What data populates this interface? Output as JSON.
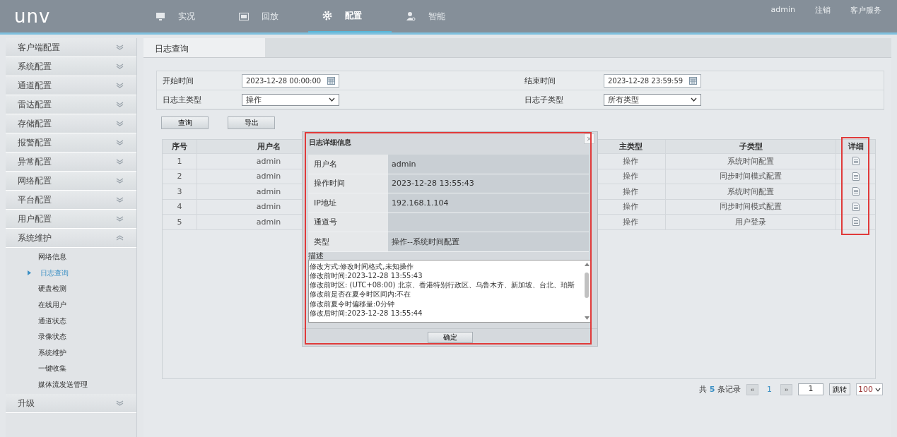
{
  "header": {
    "logo": "unv",
    "nav": [
      {
        "label": "实况",
        "kind": "monitor",
        "selected": false
      },
      {
        "label": "回放",
        "kind": "film",
        "selected": false
      },
      {
        "label": "配置",
        "kind": "gear",
        "selected": true
      },
      {
        "label": "智能",
        "kind": "person",
        "selected": false
      }
    ],
    "user": "admin",
    "links": [
      "注销",
      "客户服务"
    ]
  },
  "sidebar": {
    "items": [
      {
        "label": "客户端配置",
        "expanded": false
      },
      {
        "label": "系统配置",
        "expanded": false
      },
      {
        "label": "通道配置",
        "expanded": false
      },
      {
        "label": "雷达配置",
        "expanded": false
      },
      {
        "label": "存储配置",
        "expanded": false
      },
      {
        "label": "报警配置",
        "expanded": false
      },
      {
        "label": "异常配置",
        "expanded": false
      },
      {
        "label": "网络配置",
        "expanded": false
      },
      {
        "label": "平台配置",
        "expanded": false
      },
      {
        "label": "用户配置",
        "expanded": false
      },
      {
        "label": "系统维护",
        "expanded": true,
        "children": [
          {
            "label": "网络信息",
            "selected": false
          },
          {
            "label": "日志查询",
            "selected": true
          },
          {
            "label": "硬盘检测",
            "selected": false
          },
          {
            "label": "在线用户",
            "selected": false
          },
          {
            "label": "通道状态",
            "selected": false
          },
          {
            "label": "录像状态",
            "selected": false
          },
          {
            "label": "系统维护",
            "selected": false
          },
          {
            "label": "一键收集",
            "selected": false
          },
          {
            "label": "媒体流发送管理",
            "selected": false
          }
        ]
      },
      {
        "label": "升级",
        "expanded": false
      }
    ]
  },
  "tab": "日志查询",
  "filters": {
    "start_label": "开始时间",
    "start_value": "2023-12-28 00:00:00",
    "end_label": "结束时间",
    "end_value": "2023-12-28 23:59:59",
    "main_type_label": "日志主类型",
    "main_type_value": "操作",
    "sub_type_label": "日志子类型",
    "sub_type_value": "所有类型"
  },
  "buttons": [
    "查询",
    "导出"
  ],
  "table": {
    "columns": [
      "序号",
      "用户名",
      "主类型",
      "子类型",
      "详细"
    ],
    "rows": [
      [
        "1",
        "admin",
        "操作",
        "系统时间配置"
      ],
      [
        "2",
        "admin",
        "操作",
        "同步时间模式配置"
      ],
      [
        "3",
        "admin",
        "操作",
        "系统时间配置"
      ],
      [
        "4",
        "admin",
        "操作",
        "同步时间模式配置"
      ],
      [
        "5",
        "admin",
        "操作",
        "用户登录"
      ]
    ]
  },
  "pagination": {
    "prefix": "共",
    "count": "5",
    "suffix": "条记录",
    "prev": "«",
    "page": "1",
    "next": "»",
    "jump_value": "1",
    "jump": "跳转",
    "page_size": "100"
  },
  "dialog": {
    "title": "日志详细信息",
    "close": "×",
    "fields": [
      {
        "label": "用户名",
        "value": "admin"
      },
      {
        "label": "操作时间",
        "value": "2023-12-28 13:55:43"
      },
      {
        "label": "IP地址",
        "value": "192.168.1.104"
      },
      {
        "label": "通道号"
      },
      {
        "label": "类型",
        "value": "操作--系统时间配置"
      }
    ],
    "description_label": "描述",
    "description_lines": [
      "修改方式:修改时间格式,未知操作",
      "修改前时间:2023-12-28 13:55:43",
      "修改前时区: (UTC+08:00)  北京、香港特别行政区、乌鲁木齐、新加坡、台北、珀斯",
      "修改前是否在夏令时区间内:不在",
      "修改前夏令时偏移量:0分钟",
      "修改后时间:2023-12-28 13:55:44"
    ],
    "ok": "确定"
  }
}
